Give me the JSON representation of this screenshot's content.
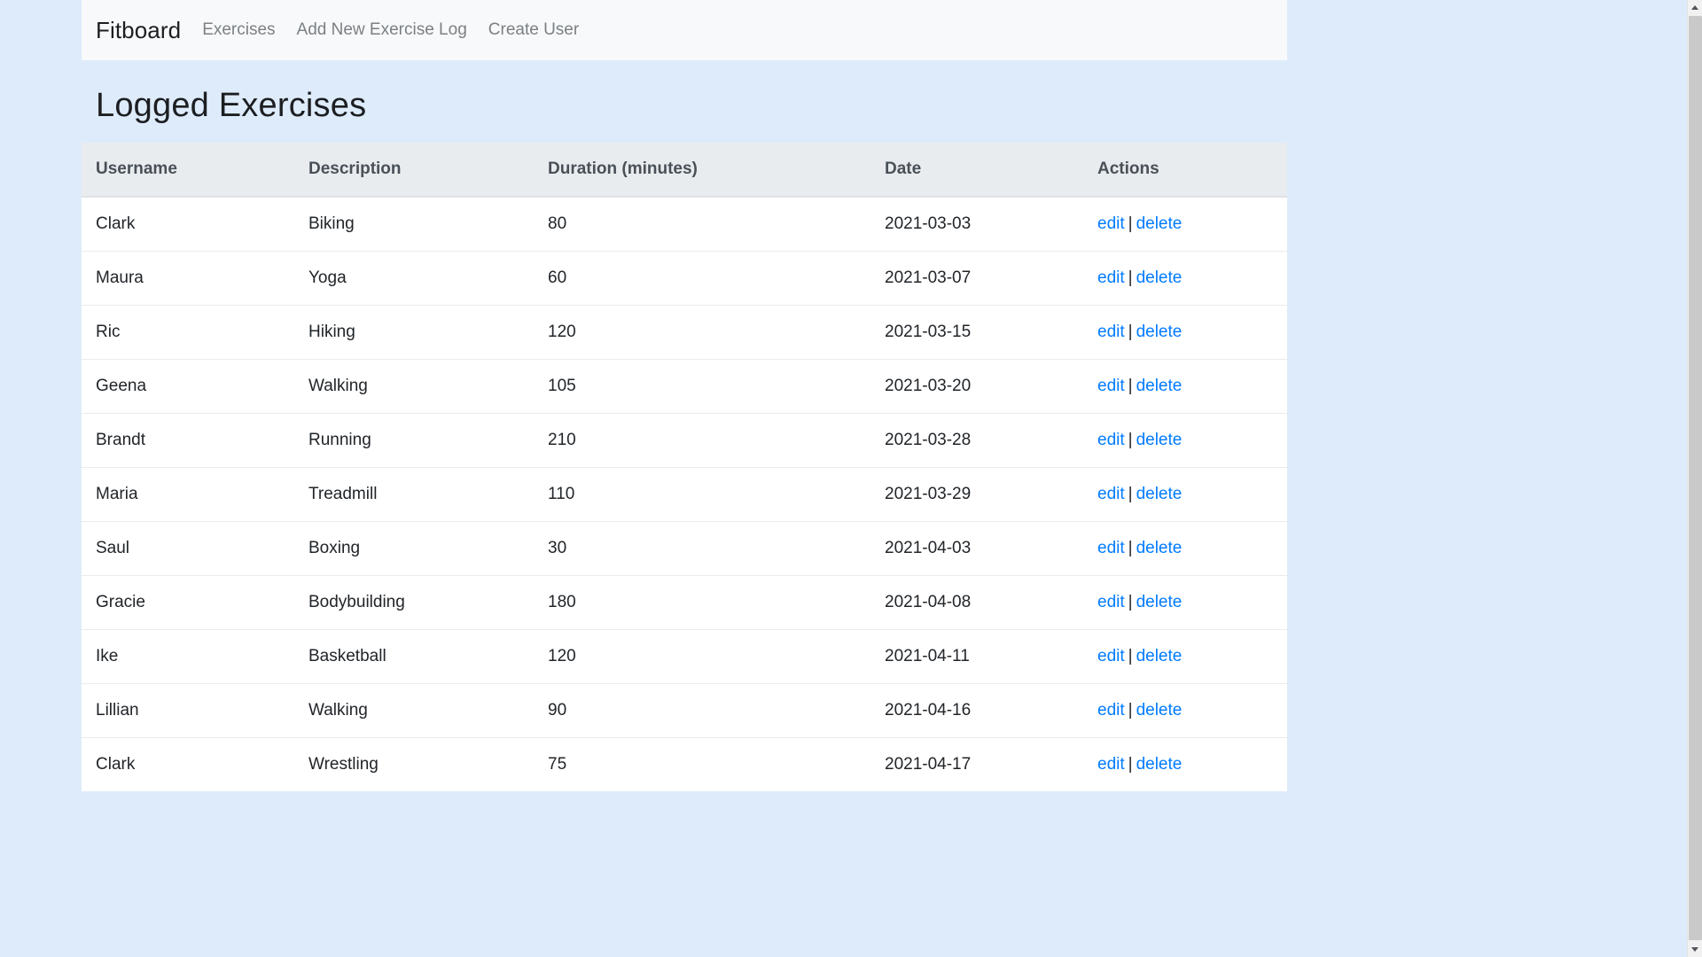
{
  "navbar": {
    "brand": "Fitboard",
    "links": [
      {
        "label": "Exercises"
      },
      {
        "label": "Add New Exercise Log"
      },
      {
        "label": "Create User"
      }
    ]
  },
  "main": {
    "title": "Logged Exercises",
    "table": {
      "columns": [
        "Username",
        "Description",
        "Duration (minutes)",
        "Date",
        "Actions"
      ],
      "actions": {
        "edit": "edit",
        "separator": "|",
        "delete": "delete"
      },
      "rows": [
        {
          "username": "Clark",
          "description": "Biking",
          "duration": "80",
          "date": "2021-03-03"
        },
        {
          "username": "Maura",
          "description": "Yoga",
          "duration": "60",
          "date": "2021-03-07"
        },
        {
          "username": "Ric",
          "description": "Hiking",
          "duration": "120",
          "date": "2021-03-15"
        },
        {
          "username": "Geena",
          "description": "Walking",
          "duration": "105",
          "date": "2021-03-20"
        },
        {
          "username": "Brandt",
          "description": "Running",
          "duration": "210",
          "date": "2021-03-28"
        },
        {
          "username": "Maria",
          "description": "Treadmill",
          "duration": "110",
          "date": "2021-03-29"
        },
        {
          "username": "Saul",
          "description": "Boxing",
          "duration": "30",
          "date": "2021-04-03"
        },
        {
          "username": "Gracie",
          "description": "Bodybuilding",
          "duration": "180",
          "date": "2021-04-08"
        },
        {
          "username": "Ike",
          "description": "Basketball",
          "duration": "120",
          "date": "2021-04-11"
        },
        {
          "username": "Lillian",
          "description": "Walking",
          "duration": "90",
          "date": "2021-04-16"
        },
        {
          "username": "Clark",
          "description": "Wrestling",
          "duration": "75",
          "date": "2021-04-17"
        }
      ]
    }
  },
  "colors": {
    "page_background": "#deebfb",
    "navbar_background": "#f8f9fa",
    "table_header_background": "#e9ecef",
    "link": "#007bff",
    "text": "#212529",
    "muted_text": "#7b8084"
  }
}
